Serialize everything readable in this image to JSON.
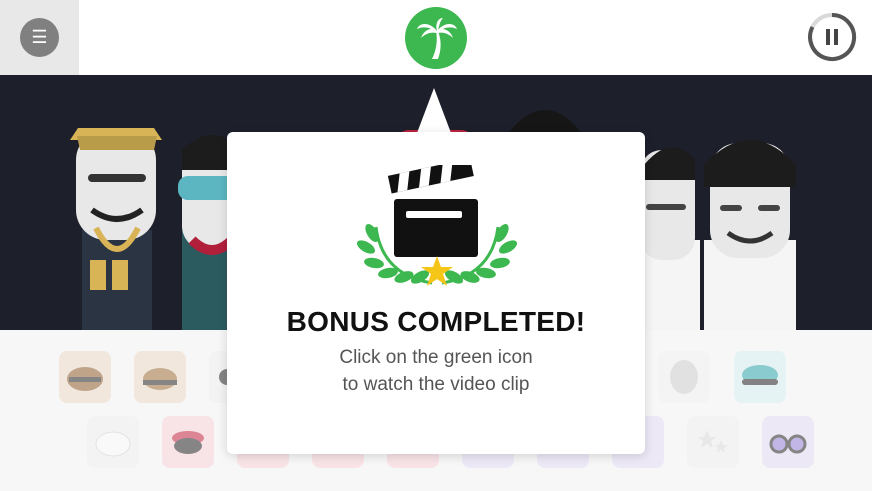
{
  "menu": {
    "icon": "hamburger-icon",
    "glyph": "☰"
  },
  "bonus": {
    "icon": "palm-tree-icon",
    "color": "#3db74f"
  },
  "pause": {
    "icon": "pause-icon",
    "glyph": "II"
  },
  "modal": {
    "title": "BONUS COMPLETED!",
    "line1": "Click on the green icon",
    "line2": "to watch the video clip",
    "icon": "clapperboard-laurel-icon"
  },
  "colors": {
    "accent": "#3db74f",
    "stage": "#1d1f2b",
    "star": "#f5c518"
  }
}
